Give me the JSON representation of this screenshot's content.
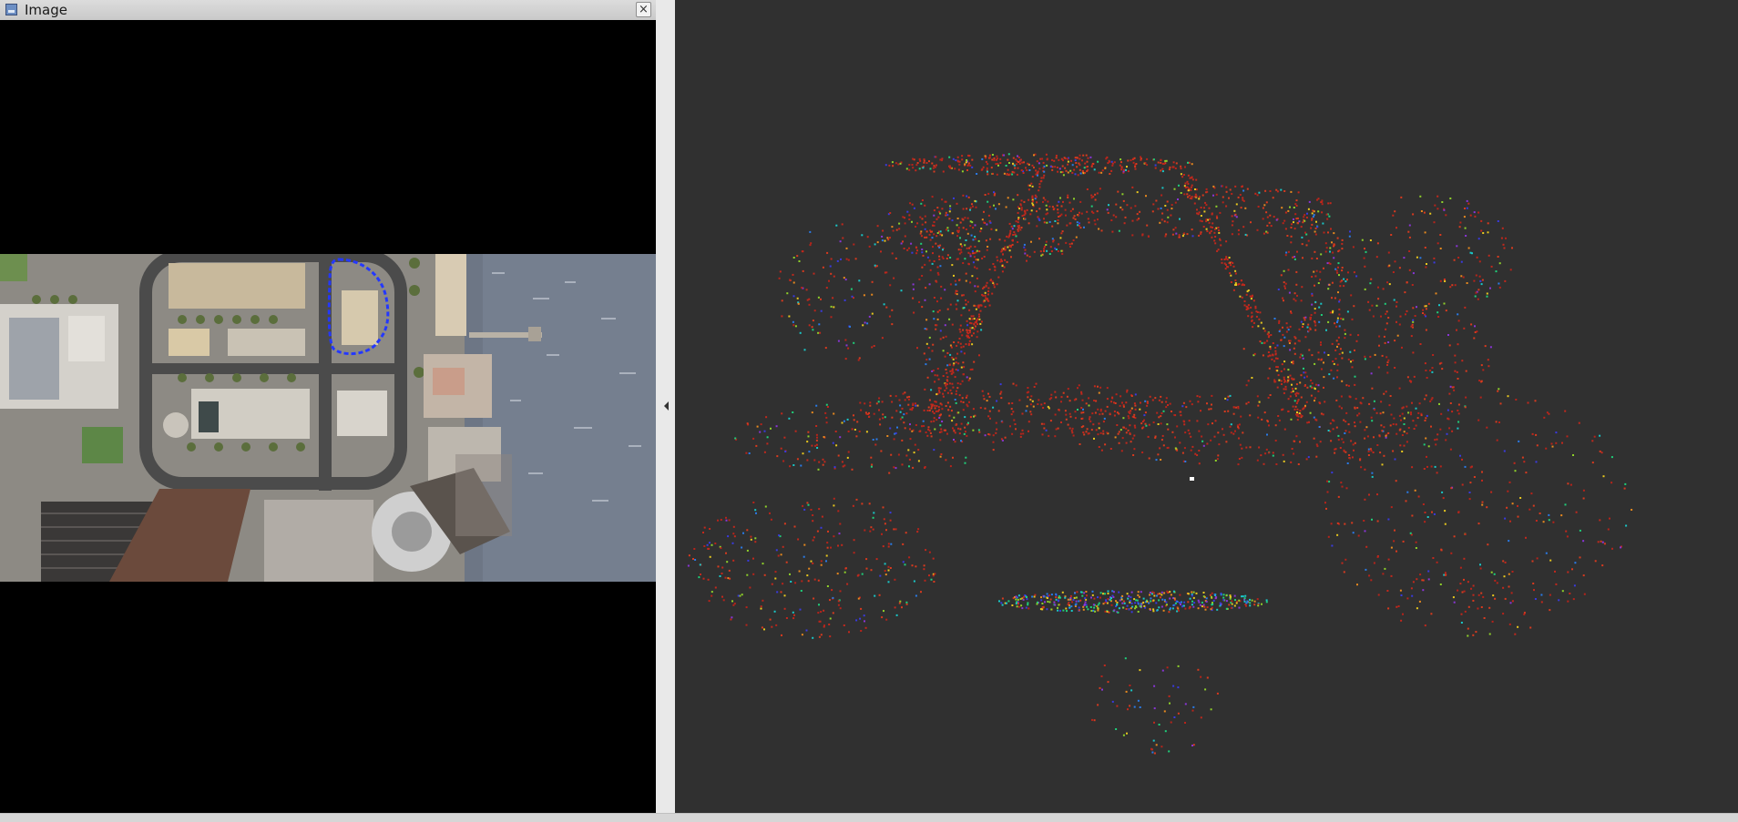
{
  "window": {
    "title": "Image",
    "icon": "image-window-icon",
    "close_glyph": "×"
  },
  "image_view": {
    "background": "#000000",
    "content": "aerial-city-map",
    "route_color": "#2438ff"
  },
  "splitter": {
    "handle_icon": "collapse-left-icon"
  },
  "viewport_3d": {
    "background": "#303030",
    "content": "point-cloud",
    "colors": [
      "#b8231a",
      "#c3281c",
      "#d93a1e",
      "#e8891e",
      "#e8c81e",
      "#8fd12a",
      "#1fd07a",
      "#19c8c8",
      "#2a7be8",
      "#3a3ae0",
      "#8a35d6"
    ]
  }
}
